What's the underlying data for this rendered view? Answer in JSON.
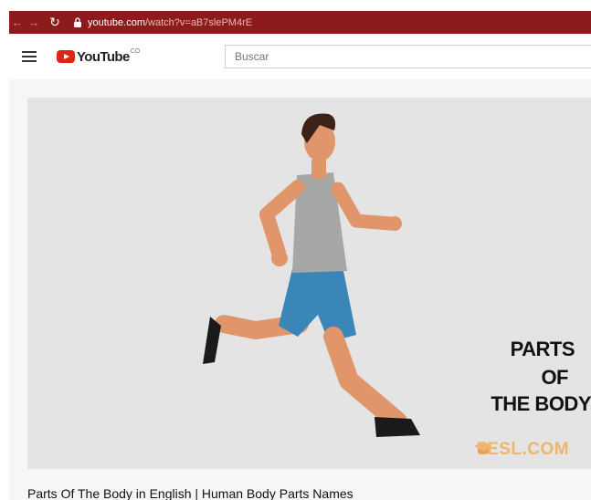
{
  "browser": {
    "url_host": "youtube.com",
    "url_path": "/watch?v=aB7slePM4rE",
    "back_icon": "arrow-left-icon",
    "forward_icon": "arrow-right-icon",
    "reload_icon": "reload-icon",
    "lock_icon": "lock-icon",
    "bar_color": "#8e1b1b"
  },
  "header": {
    "logo_text": "YouTube",
    "country_code": "CO",
    "search_placeholder": "Buscar",
    "menu_icon": "hamburger-menu-icon"
  },
  "video": {
    "thumbnail": {
      "line1": "PARTS",
      "line2": "OF",
      "line3": "THE BODY",
      "watermark": "7ESL.COM"
    },
    "title": "Parts Of The Body in English | Human Body Parts Names"
  }
}
